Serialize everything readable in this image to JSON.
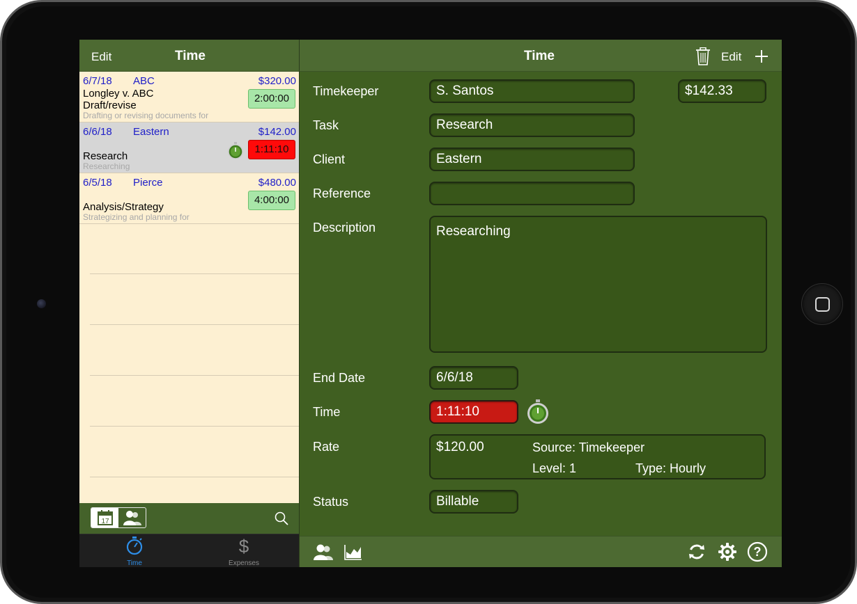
{
  "left": {
    "nav": {
      "edit_label": "Edit",
      "title": "Time"
    },
    "entries": [
      {
        "date": "6/7/18",
        "client": "ABC",
        "amount": "$320.00",
        "matter": "Longley v. ABC",
        "task": "Draft/revise",
        "description": "Drafting or revising documents for",
        "duration": "2:00:00",
        "running": false
      },
      {
        "date": "6/6/18",
        "client": "Eastern",
        "amount": "$142.00",
        "matter": "",
        "task": "Research",
        "description": "Researching",
        "duration": "1:11:10",
        "running": true
      },
      {
        "date": "6/5/18",
        "client": "Pierce",
        "amount": "$480.00",
        "matter": "",
        "task": "Analysis/Strategy",
        "description": "Strategizing and planning for",
        "duration": "4:00:00",
        "running": false
      }
    ],
    "toolbar": {
      "calendar_day": "17"
    },
    "tabs": [
      {
        "label": "Time",
        "active": true
      },
      {
        "label": "Expenses",
        "active": false
      }
    ]
  },
  "right": {
    "nav": {
      "title": "Time",
      "edit_label": "Edit"
    },
    "form": {
      "timekeeper_label": "Timekeeper",
      "timekeeper_value": "S. Santos",
      "amount_value": "$142.33",
      "task_label": "Task",
      "task_value": "Research",
      "client_label": "Client",
      "client_value": "Eastern",
      "reference_label": "Reference",
      "reference_value": "",
      "description_label": "Description",
      "description_value": "Researching",
      "end_date_label": "End Date",
      "end_date_value": "6/6/18",
      "time_label": "Time",
      "time_value": "1:11:10",
      "rate_label": "Rate",
      "rate_value": "$120.00",
      "rate_source": "Source: Timekeeper",
      "rate_level": "Level: 1",
      "rate_type": "Type: Hourly",
      "status_label": "Status",
      "status_value": "Billable"
    }
  },
  "colors": {
    "nav_green": "#4d6a32",
    "pane_green": "#405f21",
    "list_bg": "#fdf0d2",
    "link_blue": "#1e1ec8",
    "timer_red": "#ff0a0a",
    "duration_green": "#a8e6a8",
    "tab_active": "#2e8ee8"
  },
  "icons": [
    "trash-icon",
    "plus-icon",
    "stopwatch-icon",
    "calendar-icon",
    "person-icon",
    "search-icon",
    "stopwatch-tab-icon",
    "dollar-icon",
    "people-icon",
    "chart-icon",
    "sync-icon",
    "gear-icon",
    "help-icon"
  ]
}
